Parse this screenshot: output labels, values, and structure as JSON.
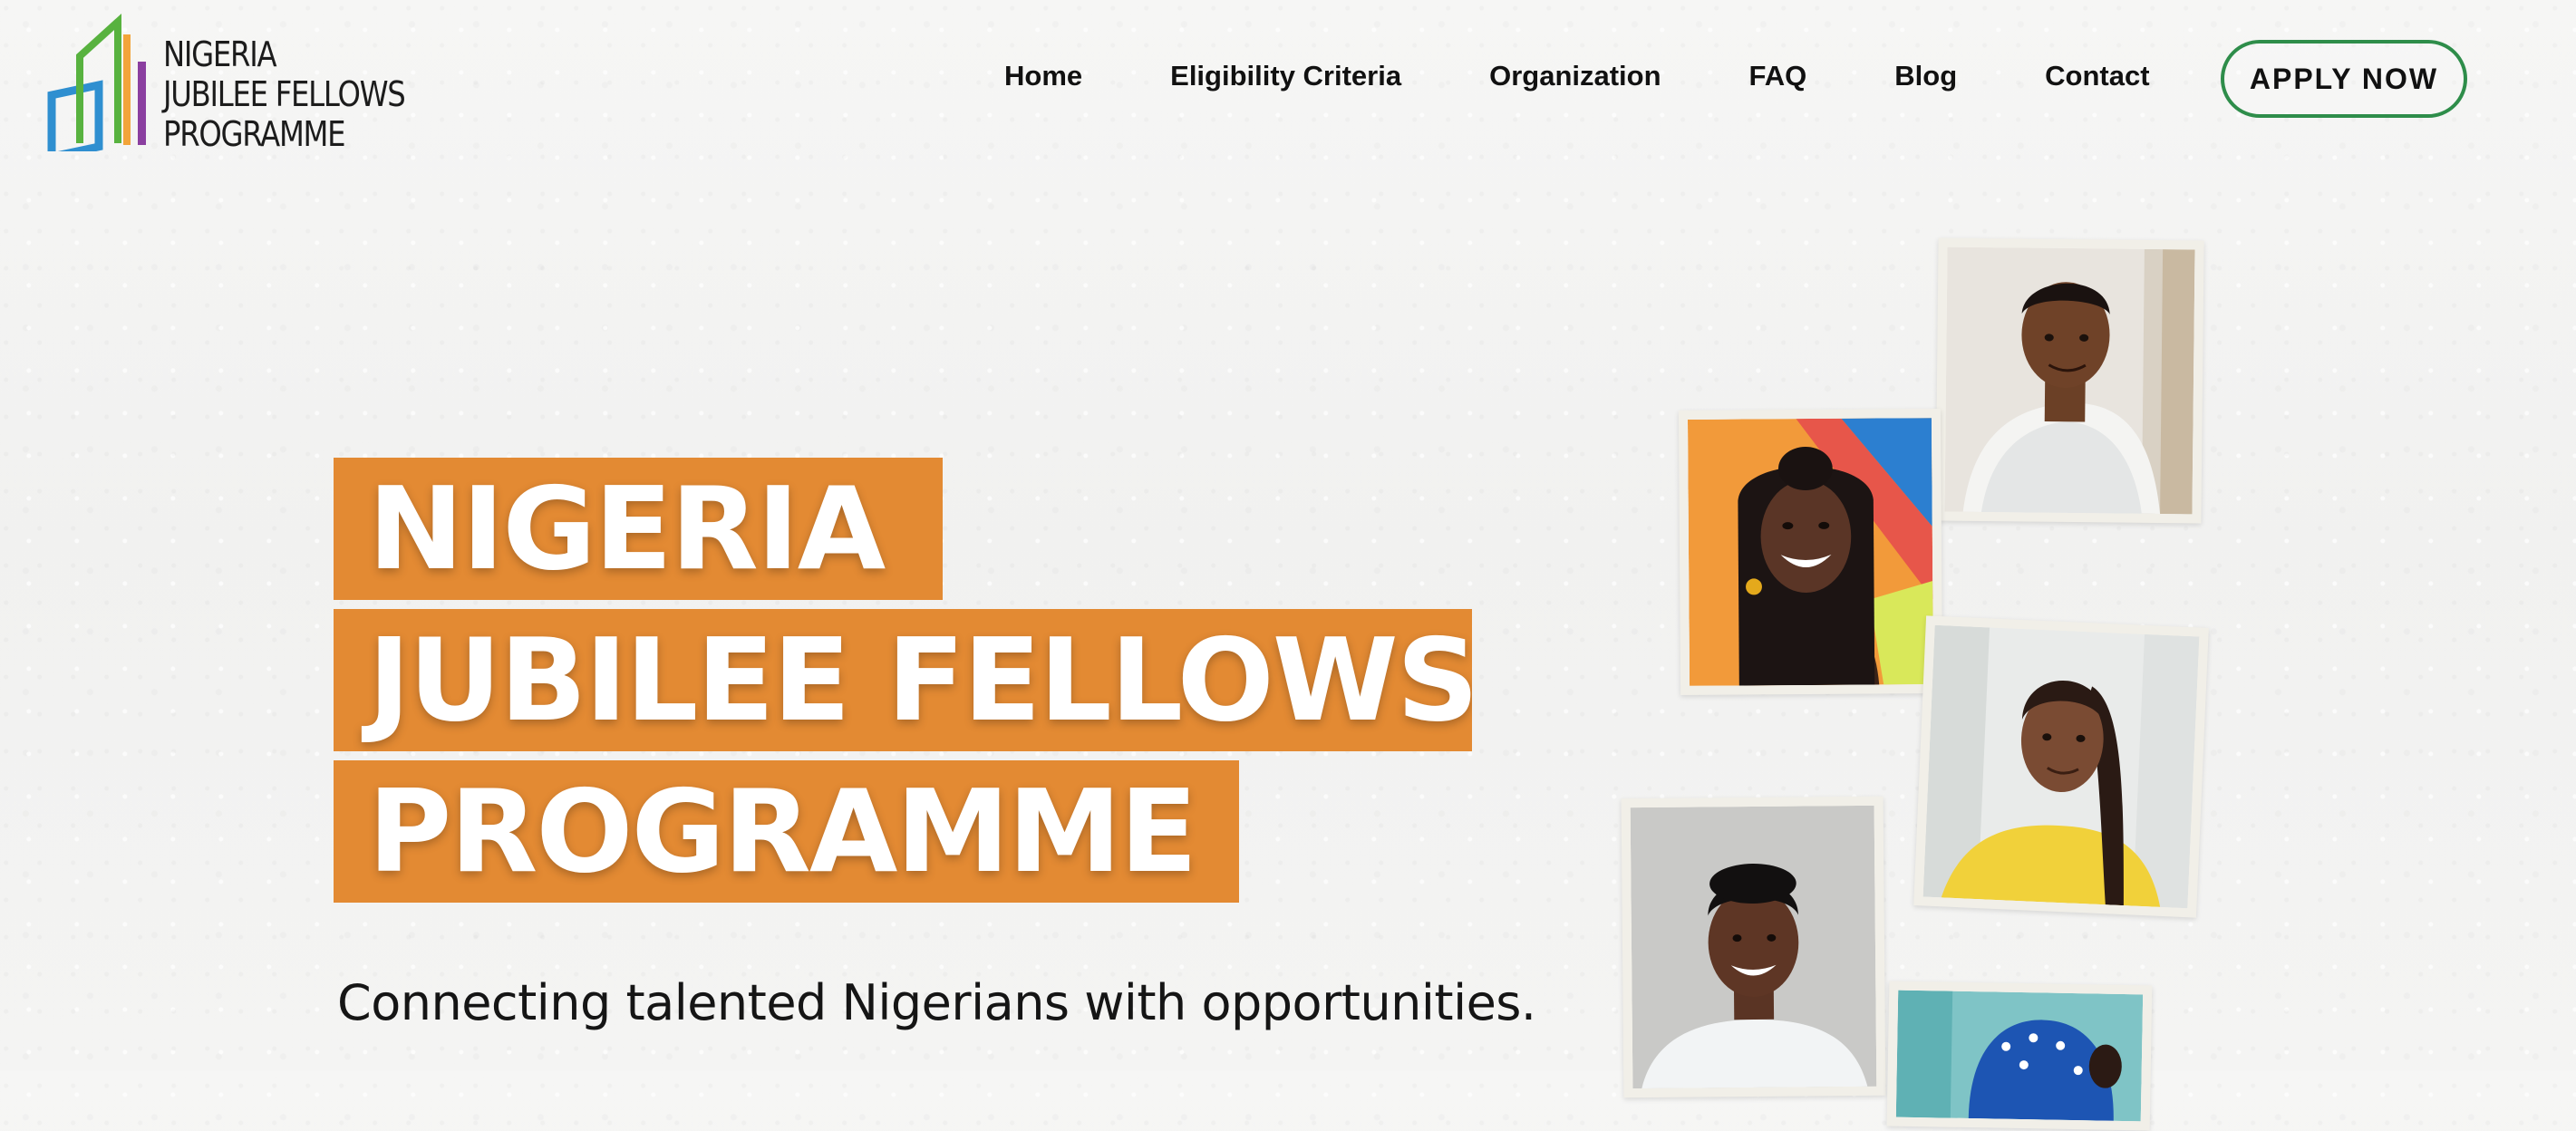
{
  "logo": {
    "line1": "NIGERIA",
    "line2": "JUBILEE FELLOWS",
    "line3": "PROGRAMME",
    "colors": {
      "blue": "#2f8fd0",
      "green": "#58b23f",
      "orange": "#f2a43a",
      "purple": "#8b3fa0"
    }
  },
  "nav": {
    "items": [
      {
        "label": "Home"
      },
      {
        "label": "Eligibility Criteria"
      },
      {
        "label": "Organization"
      },
      {
        "label": "FAQ"
      },
      {
        "label": "Blog"
      },
      {
        "label": "Contact"
      }
    ],
    "cta_label": "APPLY NOW",
    "cta_border_color": "#2e8d4a"
  },
  "hero": {
    "title_line1": "NIGERIA",
    "title_line2": "JUBILEE FELLOWS",
    "title_line3": "PROGRAMME",
    "title_bg_color": "#e38a33",
    "tagline": "Connecting talented Nigerians with opportunities."
  },
  "photos": [
    {
      "name": "young man in white shirt"
    },
    {
      "name": "smiling woman with braids on colorful background"
    },
    {
      "name": "young woman in yellow top"
    },
    {
      "name": "smiling young man in white shirt"
    },
    {
      "name": "person in blue headwrap"
    }
  ]
}
